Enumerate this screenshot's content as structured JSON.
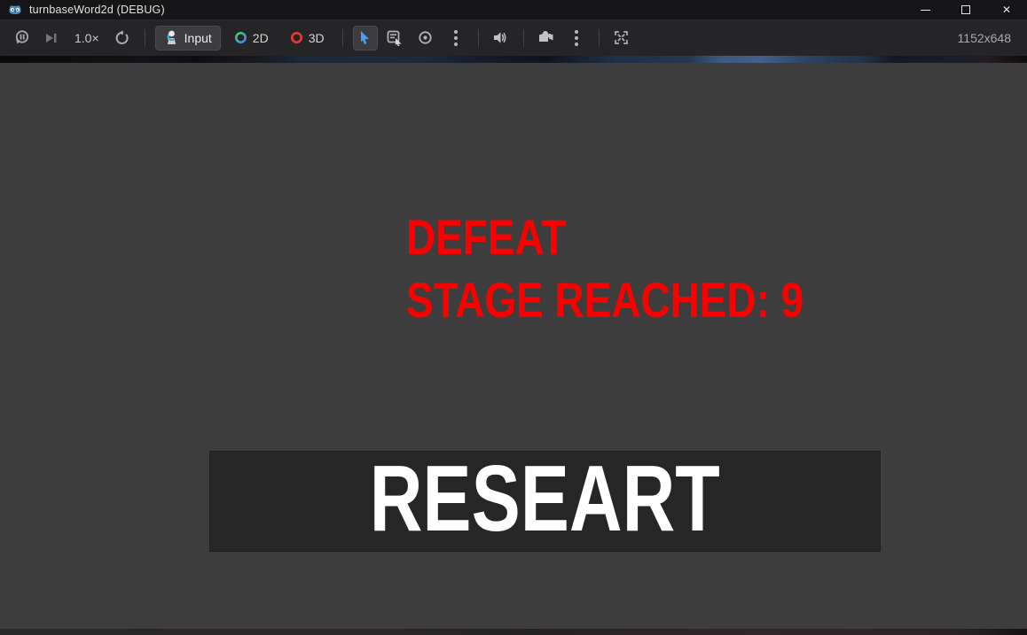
{
  "window": {
    "title": "turnbaseWord2d (DEBUG)",
    "minimize_glyph": "",
    "close_glyph": "✕"
  },
  "toolbar": {
    "speed": "1.0×",
    "input": "Input",
    "view_2d": "2D",
    "view_3d": "3D",
    "resolution": "1152x648"
  },
  "game": {
    "defeat": "DEFEAT",
    "stage_reached": "STAGE REACHED: 9",
    "restart_button": "RESEART"
  },
  "icons": [
    "godot-logo-icon",
    "break-pause-icon",
    "next-frame-icon",
    "restart-icon",
    "joypad-input-icon",
    "ring-2d-icon",
    "ring-3d-icon",
    "select-cursor-icon",
    "node-select-icon",
    "target-icon",
    "kebab-menu-icon",
    "speaker-icon",
    "camera-icon",
    "fullscreen-icon",
    "minimize-icon",
    "maximize-icon",
    "close-icon"
  ],
  "colors": {
    "titlebar_bg": "#151517",
    "toolbar_bg": "#252528",
    "viewport_bg": "#3d3d3d",
    "button_bg": "#262626",
    "alert_red": "#fb0000",
    "accent_blue": "#4a9cf5",
    "ring_green": "#45d16a",
    "ring_blue": "#4a7df0",
    "ring_red": "#e23c3c"
  }
}
